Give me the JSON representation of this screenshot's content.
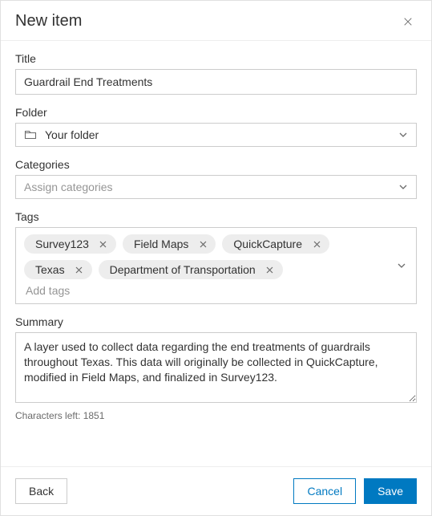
{
  "header": {
    "title": "New item"
  },
  "fields": {
    "title": {
      "label": "Title",
      "value": "Guardrail End Treatments"
    },
    "folder": {
      "label": "Folder",
      "value": "Your folder"
    },
    "categories": {
      "label": "Categories",
      "placeholder": "Assign categories"
    },
    "tags": {
      "label": "Tags",
      "items": [
        "Survey123",
        "Field Maps",
        "QuickCapture",
        "Texas",
        "Department of Transportation"
      ],
      "add_placeholder": "Add tags"
    },
    "summary": {
      "label": "Summary",
      "value": "A layer used to collect data regarding the end treatments of guardrails throughout Texas. This data will originally be collected in QuickCapture, modified in Field Maps, and finalized in Survey123.",
      "chars_left_prefix": "Characters left: ",
      "chars_left": "1851"
    }
  },
  "footer": {
    "back": "Back",
    "cancel": "Cancel",
    "save": "Save"
  }
}
